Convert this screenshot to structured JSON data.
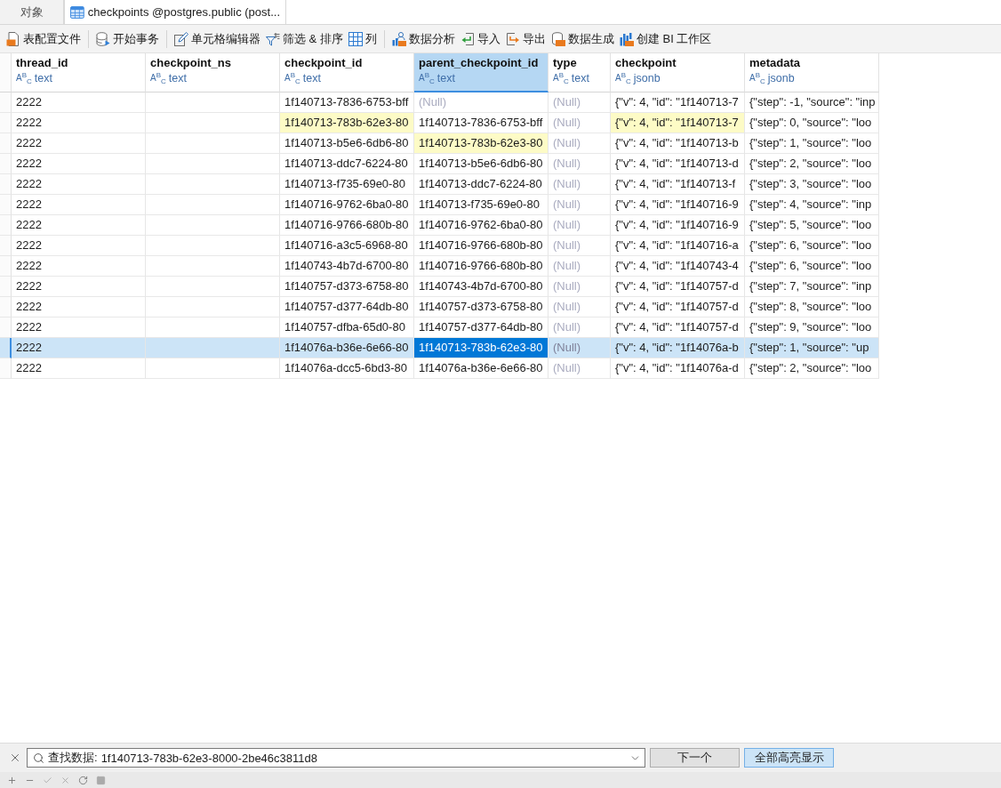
{
  "tabs": [
    {
      "label": "对象",
      "selected": false,
      "kind": "plain"
    },
    {
      "label": "checkpoints @postgres.public (post...",
      "selected": true,
      "kind": "table"
    }
  ],
  "toolbar": {
    "groups": [
      [
        {
          "label": "表配置文件"
        }
      ],
      [
        {
          "label": "开始事务"
        }
      ],
      [
        {
          "label": "单元格编辑器"
        },
        {
          "label": "筛选 & 排序"
        },
        {
          "label": "列"
        }
      ],
      [
        {
          "label": "数据分析"
        },
        {
          "label": "导入"
        },
        {
          "label": "导出"
        },
        {
          "label": "数据生成"
        },
        {
          "label": "创建 BI 工作区"
        }
      ]
    ]
  },
  "table": {
    "columns": [
      {
        "name": "thread_id",
        "type_badge": "A$^{B}$$_{C}$",
        "type": "text",
        "selected": false
      },
      {
        "name": "checkpoint_ns",
        "type_badge": "A$^{B}$$_{C}$",
        "type": "text",
        "selected": false
      },
      {
        "name": "checkpoint_id",
        "type_badge": "A$^{B}$$_{C}$",
        "type": "text",
        "selected": false
      },
      {
        "name": "parent_checkpoint_id",
        "type_badge": "A$^{B}$$_{C}$",
        "type": "text",
        "selected": true
      },
      {
        "name": "type",
        "type_badge": "A$^{B}$$_{C}$",
        "type": "text",
        "selected": false
      },
      {
        "name": "checkpoint",
        "type_badge": "A$^{B}$$_{C}$",
        "type": "jsonb",
        "selected": false
      },
      {
        "name": "metadata",
        "type_badge": "A$^{B}$$_{C}$",
        "type": "jsonb",
        "selected": false
      }
    ],
    "rows": [
      {
        "selected": false,
        "cells": [
          {
            "kind": "value",
            "text": "2222",
            "highlighted": false,
            "focused": false
          },
          {
            "kind": "empty",
            "highlighted": false,
            "focused": false
          },
          {
            "kind": "value",
            "text": "1f140713-7836-6753-bff",
            "highlighted": false,
            "focused": false
          },
          {
            "kind": "null",
            "text": "(Null)",
            "highlighted": false,
            "focused": false
          },
          {
            "kind": "null",
            "text": "(Null)",
            "highlighted": false,
            "focused": false
          },
          {
            "kind": "value",
            "text": "{\"v\": 4, \"id\": \"1f140713-7",
            "highlighted": false,
            "focused": false
          },
          {
            "kind": "value",
            "text": "{\"step\": -1, \"source\": \"inp",
            "highlighted": false,
            "focused": false
          }
        ]
      },
      {
        "selected": false,
        "cells": [
          {
            "kind": "value",
            "text": "2222",
            "highlighted": false,
            "focused": false
          },
          {
            "kind": "empty",
            "highlighted": false,
            "focused": false
          },
          {
            "kind": "value",
            "text": "1f140713-783b-62e3-80",
            "highlighted": true,
            "focused": false
          },
          {
            "kind": "value",
            "text": "1f140713-7836-6753-bff",
            "highlighted": false,
            "focused": false
          },
          {
            "kind": "null",
            "text": "(Null)",
            "highlighted": false,
            "focused": false
          },
          {
            "kind": "value",
            "text": "{\"v\": 4, \"id\": \"1f140713-7",
            "highlighted": true,
            "focused": false
          },
          {
            "kind": "value",
            "text": "{\"step\": 0, \"source\": \"loo",
            "highlighted": false,
            "focused": false
          }
        ]
      },
      {
        "selected": false,
        "cells": [
          {
            "kind": "value",
            "text": "2222",
            "highlighted": false,
            "focused": false
          },
          {
            "kind": "empty",
            "highlighted": false,
            "focused": false
          },
          {
            "kind": "value",
            "text": "1f140713-b5e6-6db6-80",
            "highlighted": false,
            "focused": false
          },
          {
            "kind": "value",
            "text": "1f140713-783b-62e3-80",
            "highlighted": true,
            "focused": false
          },
          {
            "kind": "null",
            "text": "(Null)",
            "highlighted": false,
            "focused": false
          },
          {
            "kind": "value",
            "text": "{\"v\": 4, \"id\": \"1f140713-b",
            "highlighted": false,
            "focused": false
          },
          {
            "kind": "value",
            "text": "{\"step\": 1, \"source\": \"loo",
            "highlighted": false,
            "focused": false
          }
        ]
      },
      {
        "selected": false,
        "cells": [
          {
            "kind": "value",
            "text": "2222",
            "highlighted": false,
            "focused": false
          },
          {
            "kind": "empty",
            "highlighted": false,
            "focused": false
          },
          {
            "kind": "value",
            "text": "1f140713-ddc7-6224-80",
            "highlighted": false,
            "focused": false
          },
          {
            "kind": "value",
            "text": "1f140713-b5e6-6db6-80",
            "highlighted": false,
            "focused": false
          },
          {
            "kind": "null",
            "text": "(Null)",
            "highlighted": false,
            "focused": false
          },
          {
            "kind": "value",
            "text": "{\"v\": 4, \"id\": \"1f140713-d",
            "highlighted": false,
            "focused": false
          },
          {
            "kind": "value",
            "text": "{\"step\": 2, \"source\": \"loo",
            "highlighted": false,
            "focused": false
          }
        ]
      },
      {
        "selected": false,
        "cells": [
          {
            "kind": "value",
            "text": "2222",
            "highlighted": false,
            "focused": false
          },
          {
            "kind": "empty",
            "highlighted": false,
            "focused": false
          },
          {
            "kind": "value",
            "text": "1f140713-f735-69e0-80",
            "highlighted": false,
            "focused": false
          },
          {
            "kind": "value",
            "text": "1f140713-ddc7-6224-80",
            "highlighted": false,
            "focused": false
          },
          {
            "kind": "null",
            "text": "(Null)",
            "highlighted": false,
            "focused": false
          },
          {
            "kind": "value",
            "text": "{\"v\": 4, \"id\": \"1f140713-f",
            "highlighted": false,
            "focused": false
          },
          {
            "kind": "value",
            "text": "{\"step\": 3, \"source\": \"loo",
            "highlighted": false,
            "focused": false
          }
        ]
      },
      {
        "selected": false,
        "cells": [
          {
            "kind": "value",
            "text": "2222",
            "highlighted": false,
            "focused": false
          },
          {
            "kind": "empty",
            "highlighted": false,
            "focused": false
          },
          {
            "kind": "value",
            "text": "1f140716-9762-6ba0-80",
            "highlighted": false,
            "focused": false
          },
          {
            "kind": "value",
            "text": "1f140713-f735-69e0-80",
            "highlighted": false,
            "focused": false
          },
          {
            "kind": "null",
            "text": "(Null)",
            "highlighted": false,
            "focused": false
          },
          {
            "kind": "value",
            "text": "{\"v\": 4, \"id\": \"1f140716-9",
            "highlighted": false,
            "focused": false
          },
          {
            "kind": "value",
            "text": "{\"step\": 4, \"source\": \"inp",
            "highlighted": false,
            "focused": false
          }
        ]
      },
      {
        "selected": false,
        "cells": [
          {
            "kind": "value",
            "text": "2222",
            "highlighted": false,
            "focused": false
          },
          {
            "kind": "empty",
            "highlighted": false,
            "focused": false
          },
          {
            "kind": "value",
            "text": "1f140716-9766-680b-80",
            "highlighted": false,
            "focused": false
          },
          {
            "kind": "value",
            "text": "1f140716-9762-6ba0-80",
            "highlighted": false,
            "focused": false
          },
          {
            "kind": "null",
            "text": "(Null)",
            "highlighted": false,
            "focused": false
          },
          {
            "kind": "value",
            "text": "{\"v\": 4, \"id\": \"1f140716-9",
            "highlighted": false,
            "focused": false
          },
          {
            "kind": "value",
            "text": "{\"step\": 5, \"source\": \"loo",
            "highlighted": false,
            "focused": false
          }
        ]
      },
      {
        "selected": false,
        "cells": [
          {
            "kind": "value",
            "text": "2222",
            "highlighted": false,
            "focused": false
          },
          {
            "kind": "empty",
            "highlighted": false,
            "focused": false
          },
          {
            "kind": "value",
            "text": "1f140716-a3c5-6968-80",
            "highlighted": false,
            "focused": false
          },
          {
            "kind": "value",
            "text": "1f140716-9766-680b-80",
            "highlighted": false,
            "focused": false
          },
          {
            "kind": "null",
            "text": "(Null)",
            "highlighted": false,
            "focused": false
          },
          {
            "kind": "value",
            "text": "{\"v\": 4, \"id\": \"1f140716-a",
            "highlighted": false,
            "focused": false
          },
          {
            "kind": "value",
            "text": "{\"step\": 6, \"source\": \"loo",
            "highlighted": false,
            "focused": false
          }
        ]
      },
      {
        "selected": false,
        "cells": [
          {
            "kind": "value",
            "text": "2222",
            "highlighted": false,
            "focused": false
          },
          {
            "kind": "empty",
            "highlighted": false,
            "focused": false
          },
          {
            "kind": "value",
            "text": "1f140743-4b7d-6700-80",
            "highlighted": false,
            "focused": false
          },
          {
            "kind": "value",
            "text": "1f140716-9766-680b-80",
            "highlighted": false,
            "focused": false
          },
          {
            "kind": "null",
            "text": "(Null)",
            "highlighted": false,
            "focused": false
          },
          {
            "kind": "value",
            "text": "{\"v\": 4, \"id\": \"1f140743-4",
            "highlighted": false,
            "focused": false
          },
          {
            "kind": "value",
            "text": "{\"step\": 6, \"source\": \"loo",
            "highlighted": false,
            "focused": false
          }
        ]
      },
      {
        "selected": false,
        "cells": [
          {
            "kind": "value",
            "text": "2222",
            "highlighted": false,
            "focused": false
          },
          {
            "kind": "empty",
            "highlighted": false,
            "focused": false
          },
          {
            "kind": "value",
            "text": "1f140757-d373-6758-80",
            "highlighted": false,
            "focused": false
          },
          {
            "kind": "value",
            "text": "1f140743-4b7d-6700-80",
            "highlighted": false,
            "focused": false
          },
          {
            "kind": "null",
            "text": "(Null)",
            "highlighted": false,
            "focused": false
          },
          {
            "kind": "value",
            "text": "{\"v\": 4, \"id\": \"1f140757-d",
            "highlighted": false,
            "focused": false
          },
          {
            "kind": "value",
            "text": "{\"step\": 7, \"source\": \"inp",
            "highlighted": false,
            "focused": false
          }
        ]
      },
      {
        "selected": false,
        "cells": [
          {
            "kind": "value",
            "text": "2222",
            "highlighted": false,
            "focused": false
          },
          {
            "kind": "empty",
            "highlighted": false,
            "focused": false
          },
          {
            "kind": "value",
            "text": "1f140757-d377-64db-80",
            "highlighted": false,
            "focused": false
          },
          {
            "kind": "value",
            "text": "1f140757-d373-6758-80",
            "highlighted": false,
            "focused": false
          },
          {
            "kind": "null",
            "text": "(Null)",
            "highlighted": false,
            "focused": false
          },
          {
            "kind": "value",
            "text": "{\"v\": 4, \"id\": \"1f140757-d",
            "highlighted": false,
            "focused": false
          },
          {
            "kind": "value",
            "text": "{\"step\": 8, \"source\": \"loo",
            "highlighted": false,
            "focused": false
          }
        ]
      },
      {
        "selected": false,
        "cells": [
          {
            "kind": "value",
            "text": "2222",
            "highlighted": false,
            "focused": false
          },
          {
            "kind": "empty",
            "highlighted": false,
            "focused": false
          },
          {
            "kind": "value",
            "text": "1f140757-dfba-65d0-80",
            "highlighted": false,
            "focused": false
          },
          {
            "kind": "value",
            "text": "1f140757-d377-64db-80",
            "highlighted": false,
            "focused": false
          },
          {
            "kind": "null",
            "text": "(Null)",
            "highlighted": false,
            "focused": false
          },
          {
            "kind": "value",
            "text": "{\"v\": 4, \"id\": \"1f140757-d",
            "highlighted": false,
            "focused": false
          },
          {
            "kind": "value",
            "text": "{\"step\": 9, \"source\": \"loo",
            "highlighted": false,
            "focused": false
          }
        ]
      },
      {
        "selected": true,
        "cells": [
          {
            "kind": "value",
            "text": "2222",
            "highlighted": false,
            "focused": false
          },
          {
            "kind": "empty",
            "highlighted": false,
            "focused": false
          },
          {
            "kind": "value",
            "text": "1f14076a-b36e-6e66-80",
            "highlighted": false,
            "focused": false
          },
          {
            "kind": "value",
            "text": "1f140713-783b-62e3-80",
            "highlighted": false,
            "focused": true
          },
          {
            "kind": "null",
            "text": "(Null)",
            "highlighted": false,
            "focused": false
          },
          {
            "kind": "value",
            "text": "{\"v\": 4, \"id\": \"1f14076a-b",
            "highlighted": false,
            "focused": false
          },
          {
            "kind": "value",
            "text": "{\"step\": 1, \"source\": \"up",
            "highlighted": false,
            "focused": false
          }
        ]
      },
      {
        "selected": false,
        "cells": [
          {
            "kind": "value",
            "text": "2222",
            "highlighted": false,
            "focused": false
          },
          {
            "kind": "empty",
            "highlighted": false,
            "focused": false
          },
          {
            "kind": "value",
            "text": "1f14076a-dcc5-6bd3-80",
            "highlighted": false,
            "focused": false
          },
          {
            "kind": "value",
            "text": "1f14076a-b36e-6e66-80",
            "highlighted": false,
            "focused": false
          },
          {
            "kind": "null",
            "text": "(Null)",
            "highlighted": false,
            "focused": false
          },
          {
            "kind": "value",
            "text": "{\"v\": 4, \"id\": \"1f14076a-d",
            "highlighted": false,
            "focused": false
          },
          {
            "kind": "value",
            "text": "{\"step\": 2, \"source\": \"loo",
            "highlighted": false,
            "focused": false
          }
        ]
      }
    ]
  },
  "find_bar": {
    "label": "查找数据:",
    "value": "1f140713-783b-62e3-8000-2be46c3811d8",
    "buttons": [
      {
        "label": "下一个",
        "pressed": false
      },
      {
        "label": "全部高亮显示",
        "pressed": true
      }
    ]
  }
}
